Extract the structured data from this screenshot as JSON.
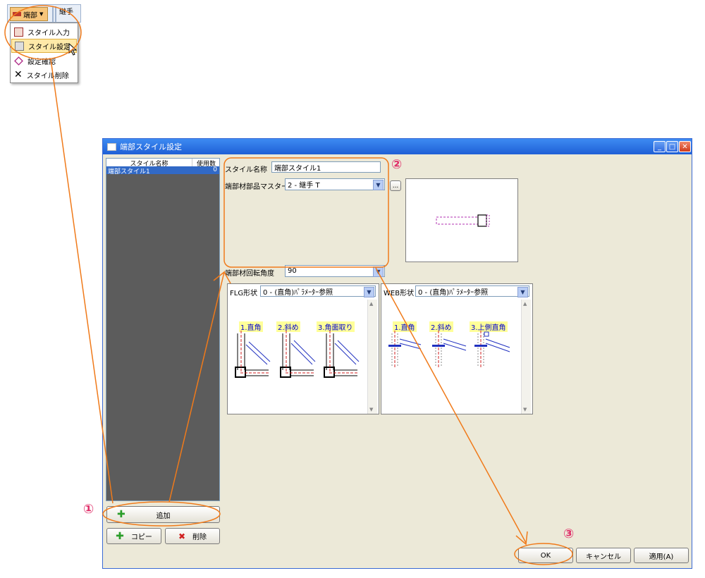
{
  "ribbon": {
    "end_button_label": "端部",
    "joint_label": "継手",
    "menu": [
      {
        "label": "スタイル入力"
      },
      {
        "label": "スタイル設定"
      },
      {
        "label": "設定確認"
      },
      {
        "label": "スタイル削除"
      }
    ]
  },
  "dialog": {
    "title": "端部スタイル設定",
    "list": {
      "headers": [
        "スタイル名称",
        "使用数"
      ],
      "rows": [
        {
          "name": "端部スタイル1",
          "count": "0"
        }
      ]
    },
    "buttons": {
      "add": "追加",
      "copy": "コピー",
      "delete": "削除"
    },
    "style_name_label": "スタイル名称",
    "style_name_value": "端部スタイル1",
    "master_label": "端部材部品マスター",
    "master_value": "2 - 継手 T",
    "browse": "...",
    "angle_label": "端部材回転角度",
    "angle_value": "90",
    "flg": {
      "label": "FLG形状",
      "value": "0 - (直角)ﾊﾟﾗﾒｰﾀｰ参照",
      "options": [
        "1.直角",
        "2.斜め",
        "3.角面取り"
      ]
    },
    "web": {
      "label": "WEB形状",
      "value": "0 - (直角)ﾊﾟﾗﾒｰﾀｰ参照",
      "options": [
        "1.直角",
        "2.斜め",
        "3.上側直角"
      ]
    },
    "ok": "OK",
    "cancel": "キャンセル",
    "apply": "適用(A)"
  },
  "annotations": {
    "step1": "①",
    "step2": "②",
    "step3": "③"
  },
  "colors": {
    "annotation": "#f07a1a",
    "step_number": "#e0306a",
    "titlebar": "#1f5fd6"
  }
}
